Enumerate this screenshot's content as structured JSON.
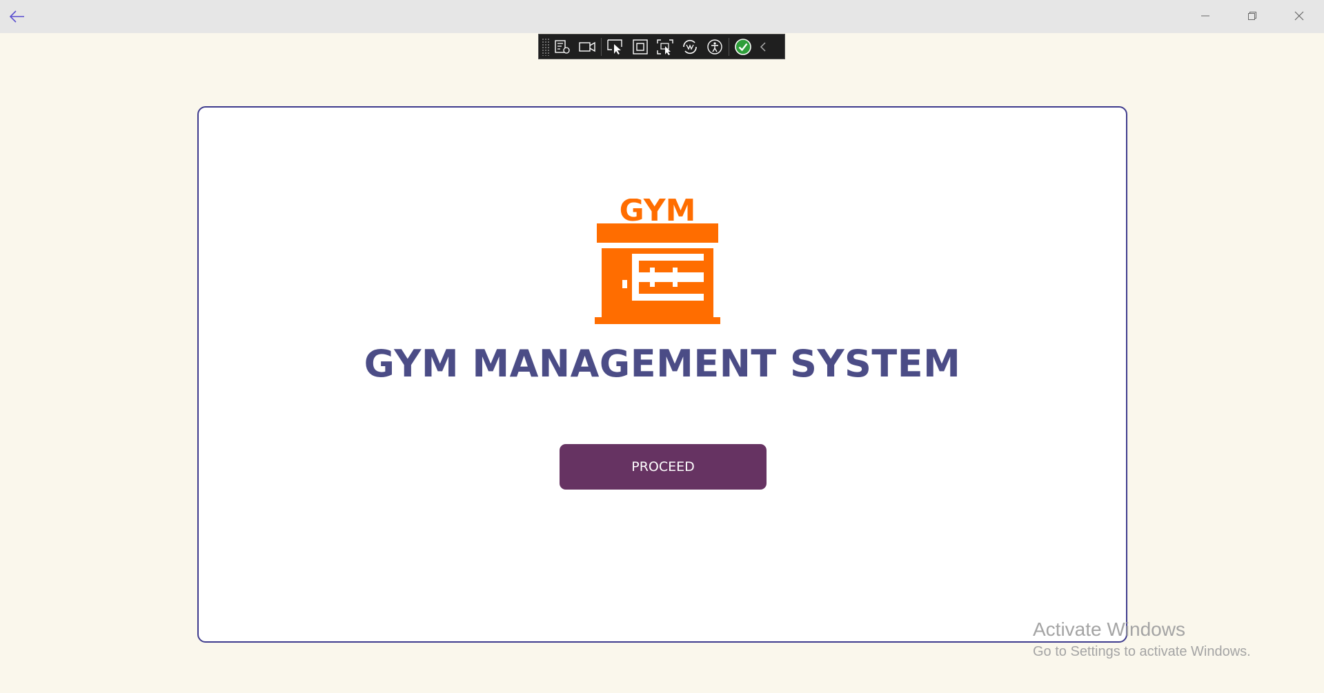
{
  "window": {
    "back_icon": "arrow-left-icon",
    "controls": {
      "minimize_icon": "minimize-icon",
      "maximize_icon": "restore-icon",
      "close_icon": "close-icon"
    }
  },
  "dev_toolbar": {
    "items": [
      "live-visual-tree-icon",
      "record-icon",
      "select-element-icon",
      "display-layout-adorners-icon",
      "track-focus-icon",
      "hot-reload-icon",
      "accessibility-icon",
      "check-status-icon",
      "collapse-chevron-icon"
    ],
    "status_color": "#2e9e3a"
  },
  "splash": {
    "logo_text": "GYM",
    "title": "GYM MANAGEMENT SYSTEM",
    "proceed_label": "PROCEED"
  },
  "colors": {
    "accent_orange": "#ff6d00",
    "title_color": "#4b4c86",
    "button_color": "#663362",
    "card_border": "#3d3a8c",
    "background": "#faf7ec"
  },
  "watermark": {
    "title": "Activate Windows",
    "subtitle": "Go to Settings to activate Windows."
  }
}
